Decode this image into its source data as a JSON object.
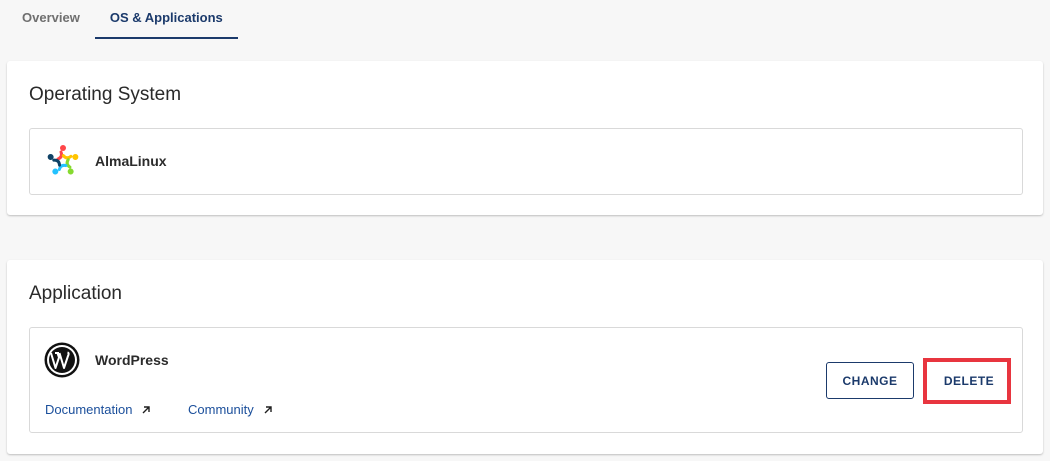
{
  "tabs": [
    {
      "label": "Overview",
      "active": false
    },
    {
      "label": "OS & Applications",
      "active": true
    }
  ],
  "os_section": {
    "title": "Operating System",
    "os_name": "AlmaLinux",
    "icon": "almalinux-logo-icon"
  },
  "app_section": {
    "title": "Application",
    "app_name": "WordPress",
    "icon": "wordpress-logo-icon",
    "links": {
      "documentation": "Documentation",
      "community": "Community"
    },
    "buttons": {
      "change": "CHANGE",
      "delete": "DELETE"
    }
  },
  "colors": {
    "accent": "#1b3a6b",
    "link": "#1b4f9b",
    "highlight": "#e8353f",
    "background": "#f7f7f7"
  }
}
